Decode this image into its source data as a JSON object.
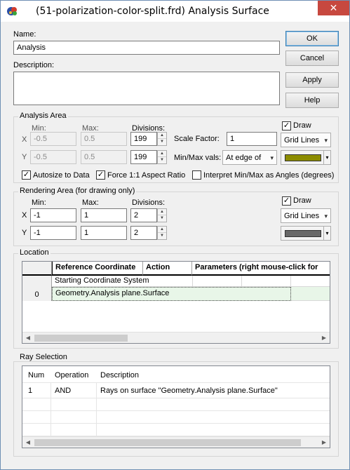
{
  "window": {
    "title": "(51-polarization-color-split.frd) Analysis Surface",
    "close_glyph": "✕",
    "app_icon": "app-icon"
  },
  "buttons": {
    "ok": "OK",
    "cancel": "Cancel",
    "apply": "Apply",
    "help": "Help"
  },
  "name": {
    "label": "Name:",
    "value": "Analysis"
  },
  "description": {
    "label": "Description:",
    "value": ""
  },
  "analysis_area": {
    "title": "Analysis Area",
    "min_label": "Min:",
    "max_label": "Max:",
    "divisions_label": "Divisions:",
    "x_label": "X",
    "y_label": "Y",
    "x_min": "-0.5",
    "x_max": "0.5",
    "x_div": "199",
    "y_min": "-0.5",
    "y_max": "0.5",
    "y_div": "199",
    "scale_factor_label": "Scale Factor:",
    "scale_factor": "1",
    "minmax_label": "Min/Max vals:",
    "minmax_value": "At edge of",
    "draw_label": "Draw",
    "draw_checked": true,
    "draw_mode": "Grid Lines",
    "color": "#8c8c00",
    "autosize_label": "Autosize to Data",
    "autosize_checked": true,
    "force_label": "Force 1:1 Aspect Ratio",
    "force_checked": true,
    "interpret_label": "Interpret Min/Max as Angles (degrees)",
    "interpret_checked": false
  },
  "rendering_area": {
    "title": "Rendering Area (for drawing only)",
    "min_label": "Min:",
    "max_label": "Max:",
    "divisions_label": "Divisions:",
    "x_label": "X",
    "y_label": "Y",
    "x_min": "-1",
    "x_max": "1",
    "x_div": "2",
    "y_min": "-1",
    "y_max": "1",
    "y_div": "2",
    "draw_label": "Draw",
    "draw_checked": true,
    "draw_mode": "Grid Lines",
    "color": "#686868"
  },
  "location": {
    "title": "Location",
    "columns": [
      "Reference Coordinate",
      "Action",
      "Parameters (right mouse-click for"
    ],
    "rows": [
      {
        "num": "",
        "ref": "Starting Coordinate System"
      },
      {
        "num": "0",
        "ref": "Geometry.Analysis plane.Surface"
      }
    ]
  },
  "ray_selection": {
    "title": "Ray Selection",
    "columns": [
      "Num",
      "Operation",
      "Description"
    ],
    "rows": [
      {
        "num": "1",
        "op": "AND",
        "desc": "Rays on surface \"Geometry.Analysis plane.Surface\""
      }
    ]
  },
  "check_glyph": "✓",
  "dropdown_glyph": "▾",
  "spin_up_glyph": "▲",
  "spin_down_glyph": "▼",
  "scroll_left_glyph": "◀",
  "scroll_right_glyph": "▶"
}
